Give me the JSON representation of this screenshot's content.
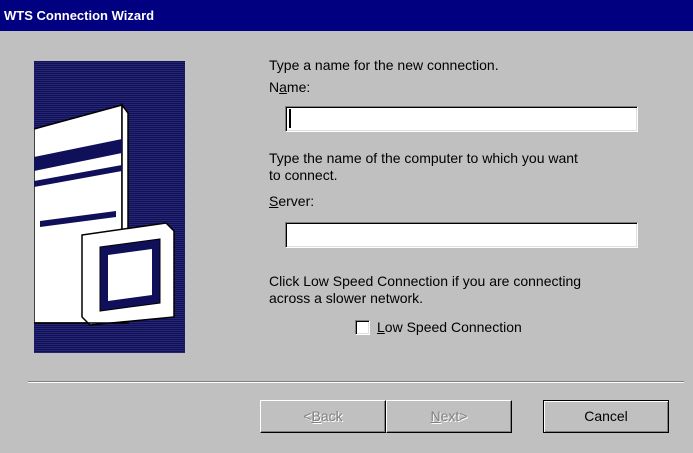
{
  "window": {
    "title": "WTS Connection Wizard"
  },
  "artwork": {
    "icon": "server-with-monitor-icon"
  },
  "name_section": {
    "instruction": "Type a name for the new connection.",
    "label_pre": "N",
    "label_accel": "a",
    "label_post": "me:",
    "value": ""
  },
  "server_section": {
    "instruction_line1": "Type the name of the computer to which you want",
    "instruction_line2": "to connect.",
    "label_pre": "",
    "label_accel": "S",
    "label_post": "erver:",
    "value": ""
  },
  "speed_section": {
    "instruction_line1": "Click Low Speed Connection if you are connecting",
    "instruction_line2": "across a slower network.",
    "checkbox_accel": "L",
    "checkbox_label_rest": "ow Speed Connection",
    "checked": false
  },
  "buttons": {
    "back_pre": "<",
    "back_accel": "B",
    "back_post": "ack",
    "next_accel": "N",
    "next_post": "ext>",
    "cancel": "Cancel"
  },
  "colors": {
    "titlebar": "#000080",
    "face": "#c0c0c0",
    "art_background": "#1a1a66"
  }
}
